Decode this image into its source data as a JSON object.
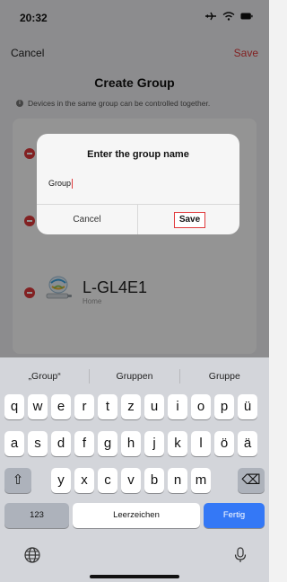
{
  "status_bar": {
    "time": "20:32",
    "icons": [
      "airplane-icon",
      "wifi-icon",
      "battery-icon"
    ]
  },
  "nav": {
    "cancel_label": "Cancel",
    "save_label": "Save"
  },
  "page": {
    "title": "Create Group",
    "info_text": "Devices in the same group can be controlled together."
  },
  "device": {
    "name": "L-GL4E1",
    "room": "Home"
  },
  "dialog": {
    "title": "Enter the group name",
    "input_value": "Group",
    "cancel_label": "Cancel",
    "save_label": "Save"
  },
  "keyboard": {
    "suggestions": [
      "„Group“",
      "Gruppen",
      "Gruppe"
    ],
    "row1": [
      "q",
      "w",
      "e",
      "r",
      "t",
      "z",
      "u",
      "i",
      "o",
      "p",
      "ü"
    ],
    "row2": [
      "a",
      "s",
      "d",
      "f",
      "g",
      "h",
      "j",
      "k",
      "l",
      "ö",
      "ä"
    ],
    "row3": [
      "y",
      "x",
      "c",
      "v",
      "b",
      "n",
      "m"
    ],
    "numbers_label": "123",
    "space_label": "Leerzeichen",
    "return_label": "Fertig",
    "shift_glyph": "⇧",
    "delete_glyph": "⌫"
  },
  "colors": {
    "accent_red": "#e0393b",
    "return_blue": "#3478f6"
  }
}
